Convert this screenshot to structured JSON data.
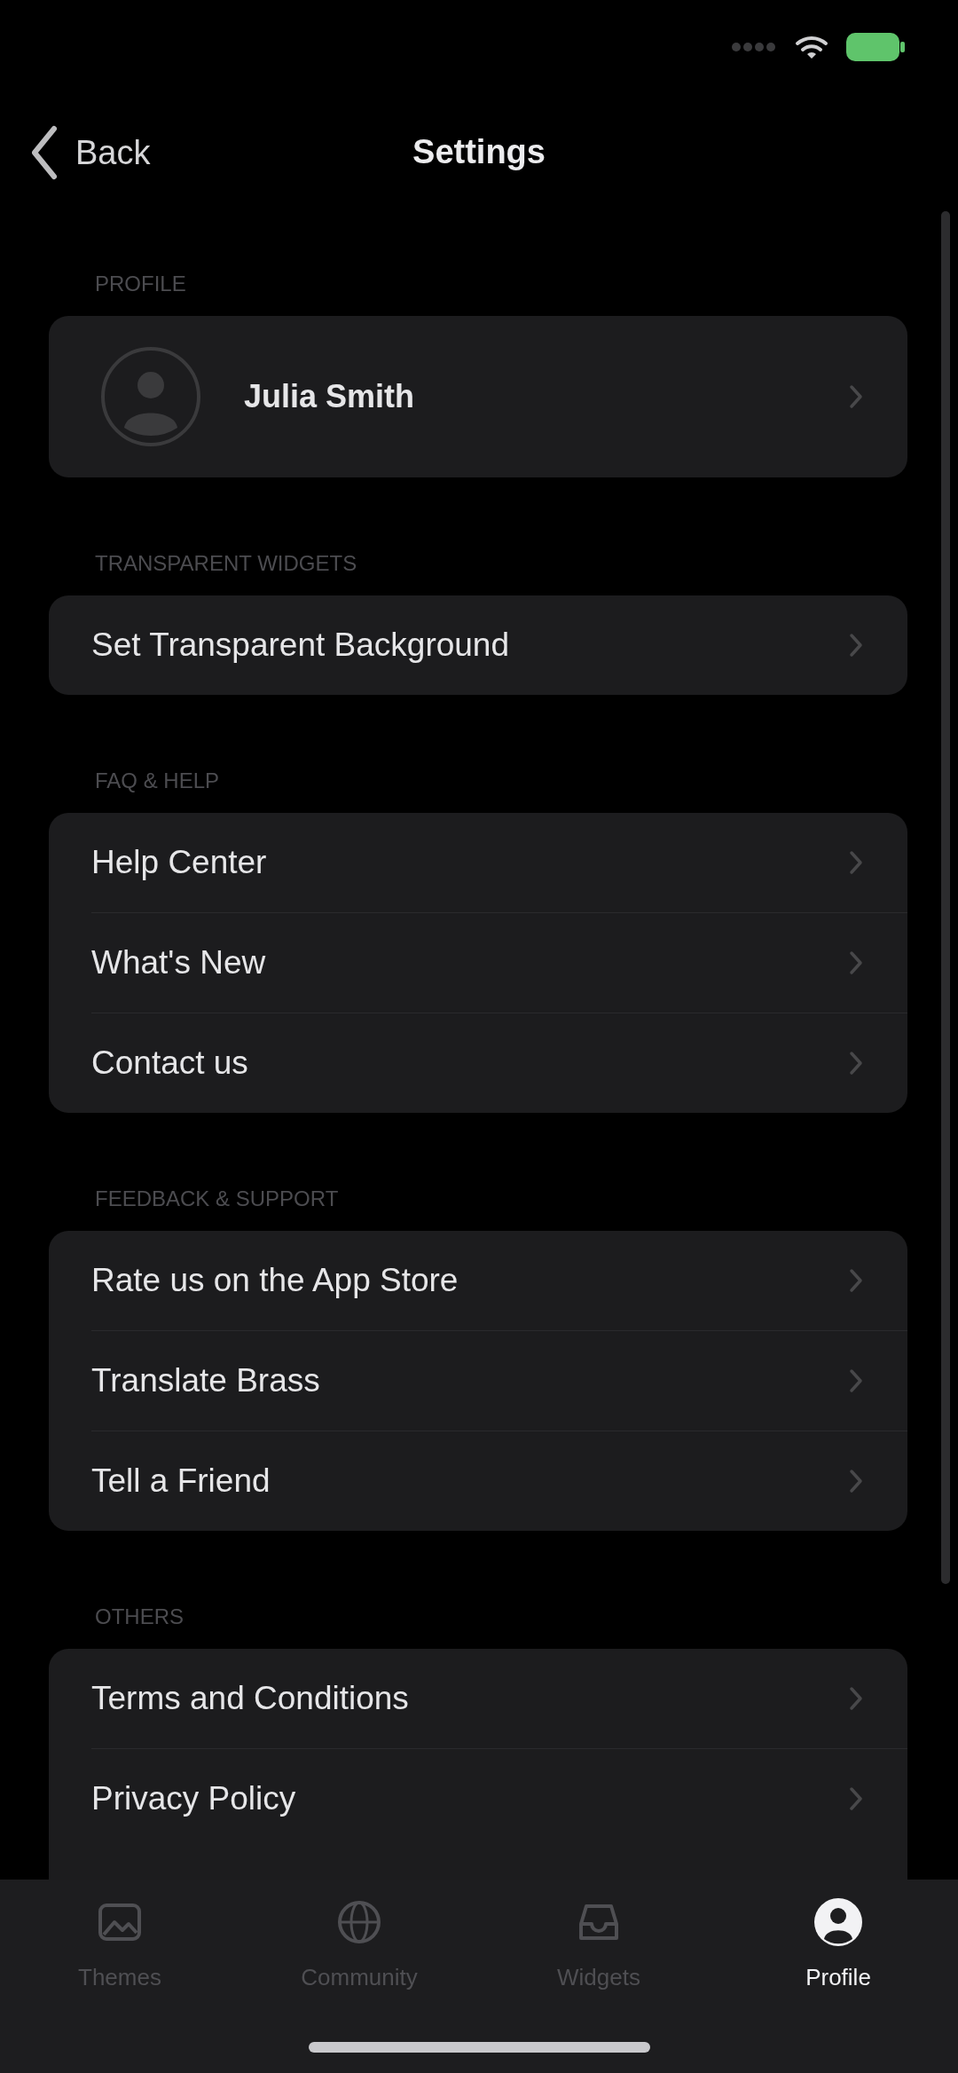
{
  "navigation": {
    "back": "Back",
    "title": "Settings"
  },
  "sections": [
    {
      "header": "PROFILE",
      "rows": [
        {
          "kind": "profile",
          "label": "Julia Smith"
        }
      ]
    },
    {
      "header": "TRANSPARENT WIDGETS",
      "rows": [
        {
          "kind": "link",
          "label": "Set Transparent Background"
        }
      ]
    },
    {
      "header": "FAQ & HELP",
      "rows": [
        {
          "kind": "link",
          "label": "Help Center"
        },
        {
          "kind": "link",
          "label": "What's New"
        },
        {
          "kind": "link",
          "label": "Contact us"
        }
      ]
    },
    {
      "header": "FEEDBACK & SUPPORT",
      "rows": [
        {
          "kind": "link",
          "label": "Rate us on the App Store"
        },
        {
          "kind": "link",
          "label": "Translate Brass"
        },
        {
          "kind": "link",
          "label": "Tell a Friend"
        }
      ]
    },
    {
      "header": "OTHERS",
      "rows": [
        {
          "kind": "link",
          "label": "Terms and Conditions"
        },
        {
          "kind": "link",
          "label": "Privacy Policy"
        }
      ]
    }
  ],
  "tab_bar": [
    {
      "kind": "image",
      "label": "Themes",
      "selected": false
    },
    {
      "kind": "globe",
      "label": "Community",
      "selected": false
    },
    {
      "kind": "tray",
      "label": "Widgets",
      "selected": false
    },
    {
      "kind": "person",
      "label": "Profile",
      "selected": true
    }
  ]
}
